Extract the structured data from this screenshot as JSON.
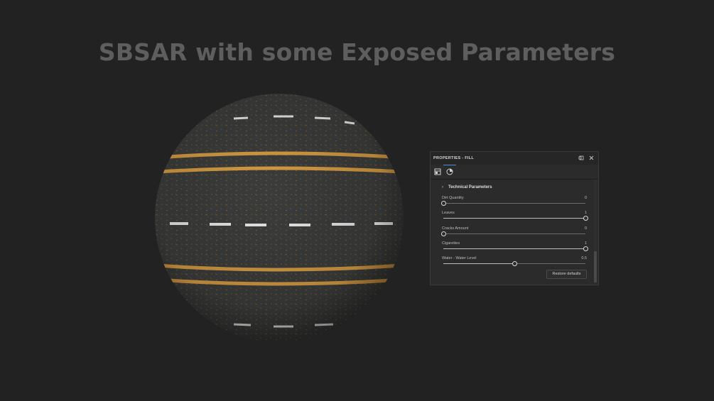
{
  "headline": "SBSAR with some Exposed Parameters",
  "panel": {
    "title": "PROPERTIES - FILL",
    "header_icons": [
      "undock-icon",
      "close-icon"
    ],
    "tabs": [
      {
        "icon": "layer-properties-icon",
        "active": false
      },
      {
        "icon": "material-sphere-icon",
        "active": true
      }
    ],
    "section": {
      "label": "Technical Parameters",
      "icon": "chevron-right-icon",
      "expanded": true
    },
    "parameters": [
      {
        "label": "Dirt Quantity",
        "value": "0",
        "fraction": 0.0
      },
      {
        "label": "Leaves",
        "value": "1",
        "fraction": 1.0
      },
      {
        "label": "Cracks Amount",
        "value": "0",
        "fraction": 0.0
      },
      {
        "label": "Cigarettes",
        "value": "1",
        "fraction": 1.0
      },
      {
        "label": "Water - Water Level",
        "value": "0.5",
        "fraction": 0.5
      }
    ],
    "restore_button": "Restore defaults"
  },
  "preview": {
    "subject": "asphalt-road-material-sphere",
    "colors": {
      "background": "#222222",
      "asphalt": "#3a3b3b",
      "yellow_line": "#d49a42",
      "white_dash": "#e6e6e6",
      "accent": "#4a90d9"
    }
  }
}
